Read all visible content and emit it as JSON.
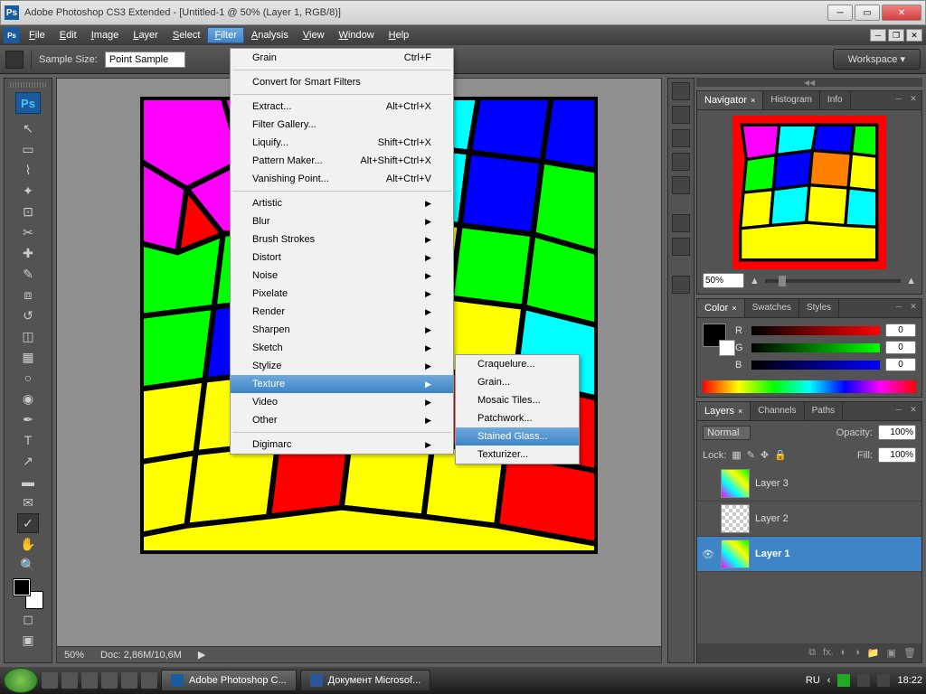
{
  "title": "Adobe Photoshop CS3 Extended - [Untitled-1 @ 50% (Layer 1, RGB/8)]",
  "menu": [
    "File",
    "Edit",
    "Image",
    "Layer",
    "Select",
    "Filter",
    "Analysis",
    "View",
    "Window",
    "Help"
  ],
  "menu_open_index": 5,
  "optbar": {
    "label": "Sample Size:",
    "value": "Point Sample",
    "workspace": "Workspace ▾"
  },
  "filterMenu": [
    {
      "t": "item",
      "label": "Grain",
      "accel": "Ctrl+F"
    },
    {
      "t": "sep"
    },
    {
      "t": "item",
      "label": "Convert for Smart Filters"
    },
    {
      "t": "sep"
    },
    {
      "t": "item",
      "label": "Extract...",
      "accel": "Alt+Ctrl+X"
    },
    {
      "t": "item",
      "label": "Filter Gallery..."
    },
    {
      "t": "item",
      "label": "Liquify...",
      "accel": "Shift+Ctrl+X"
    },
    {
      "t": "item",
      "label": "Pattern Maker...",
      "accel": "Alt+Shift+Ctrl+X"
    },
    {
      "t": "item",
      "label": "Vanishing Point...",
      "accel": "Alt+Ctrl+V"
    },
    {
      "t": "sep"
    },
    {
      "t": "sub",
      "label": "Artistic"
    },
    {
      "t": "sub",
      "label": "Blur"
    },
    {
      "t": "sub",
      "label": "Brush Strokes"
    },
    {
      "t": "sub",
      "label": "Distort"
    },
    {
      "t": "sub",
      "label": "Noise"
    },
    {
      "t": "sub",
      "label": "Pixelate"
    },
    {
      "t": "sub",
      "label": "Render"
    },
    {
      "t": "sub",
      "label": "Sharpen"
    },
    {
      "t": "sub",
      "label": "Sketch"
    },
    {
      "t": "sub",
      "label": "Stylize"
    },
    {
      "t": "sub",
      "label": "Texture",
      "hl": true
    },
    {
      "t": "sub",
      "label": "Video"
    },
    {
      "t": "sub",
      "label": "Other"
    },
    {
      "t": "sep"
    },
    {
      "t": "sub",
      "label": "Digimarc"
    }
  ],
  "textureSubmenu": [
    "Craquelure...",
    "Grain...",
    "Mosaic Tiles...",
    "Patchwork...",
    "Stained Glass...",
    "Texturizer..."
  ],
  "textureSubmenu_hl": 4,
  "nav": {
    "tabs": [
      "Navigator",
      "Histogram",
      "Info"
    ],
    "zoom": "50%"
  },
  "color": {
    "tabs": [
      "Color",
      "Swatches",
      "Styles"
    ],
    "r": "0",
    "g": "0",
    "b": "0"
  },
  "layers": {
    "tabs": [
      "Layers",
      "Channels",
      "Paths"
    ],
    "blend": "Normal",
    "opacity": "100%",
    "fill": "100%",
    "lock": "Lock:",
    "items": [
      {
        "name": "Layer 3",
        "vis": false,
        "sel": false
      },
      {
        "name": "Layer 2",
        "vis": false,
        "sel": false
      },
      {
        "name": "Layer 1",
        "vis": true,
        "sel": true
      }
    ]
  },
  "status": {
    "zoom": "50%",
    "doc": "Doc: 2,86M/10,6M"
  },
  "taskbar": {
    "apps": [
      "Adobe Photoshop C...",
      "Документ Microsof..."
    ],
    "lang": "RU",
    "time": "18:22"
  }
}
